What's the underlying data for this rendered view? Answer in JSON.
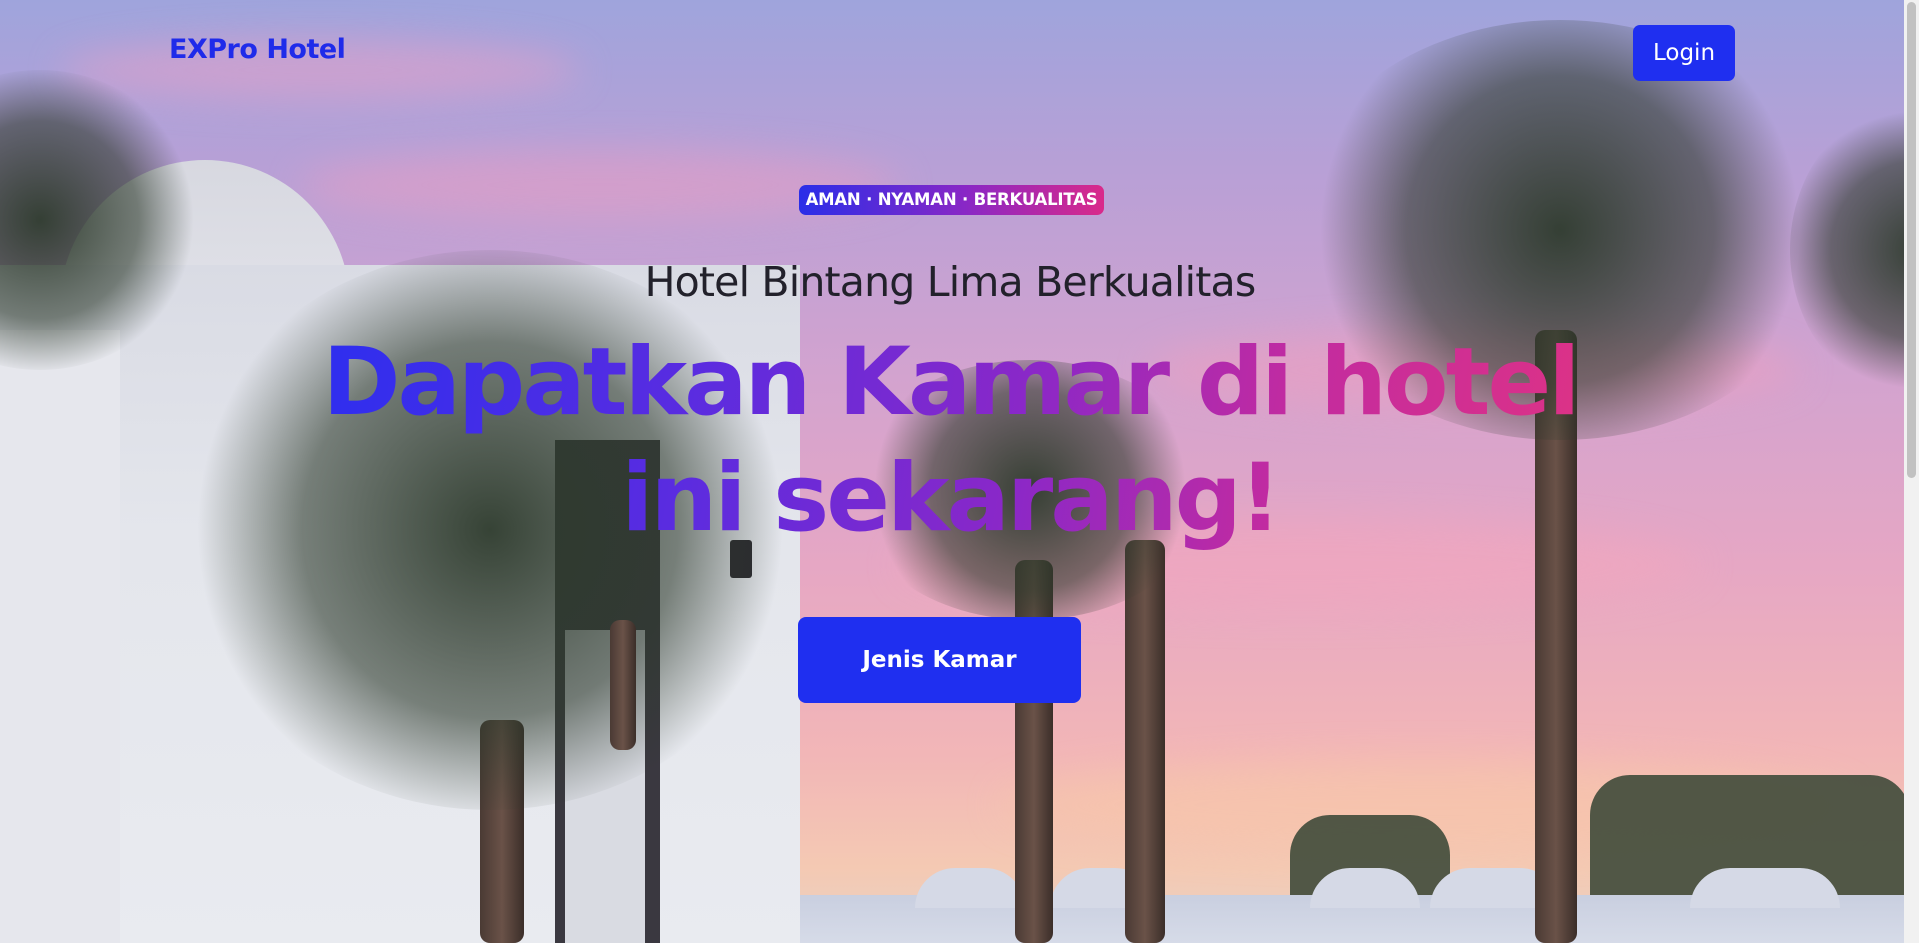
{
  "navbar": {
    "brand": "EXPro Hotel",
    "login_label": "Login"
  },
  "hero": {
    "tagline": "AMAN · NYAMAN · BERKUALITAS",
    "subtitle": "Hotel Bintang Lima Berkualitas",
    "headline": "Dapatkan Kamar di hotel ini sekarang!",
    "cta_label": "Jenis Kamar"
  },
  "colors": {
    "primary": "#1f2ff0",
    "gradient_start": "#2b2ef0",
    "gradient_end": "#e03383",
    "subtitle_text": "#22212b"
  },
  "background": {
    "scene": "hotel-palm-sunset-photo"
  }
}
